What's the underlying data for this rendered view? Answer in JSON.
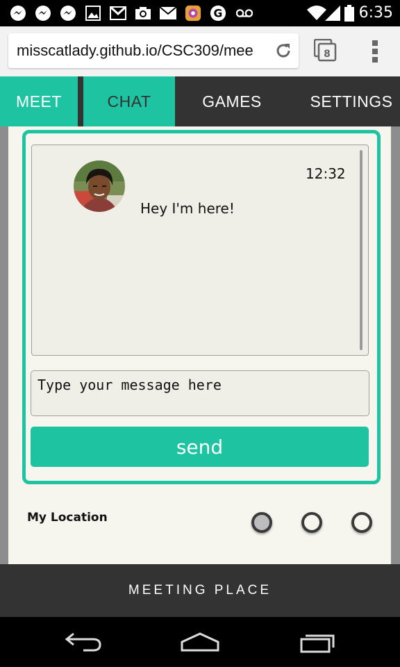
{
  "status_bar": {
    "time": "6:35",
    "icons": [
      "messenger-icon",
      "messenger-icon",
      "messenger-icon",
      "image-icon",
      "gmail-icon",
      "camera-icon",
      "mail-icon",
      "instagram-icon",
      "google-icon",
      "voicemail-icon",
      "wifi-icon",
      "signal-icon",
      "battery-icon"
    ]
  },
  "browser": {
    "url": "misscatlady.github.io/CSC309/mee",
    "tab_count": "8"
  },
  "nav": {
    "tabs": [
      {
        "label": "MEET"
      },
      {
        "label": "CHAT"
      },
      {
        "label": "GAMES"
      },
      {
        "label": "SETTINGS"
      }
    ],
    "active": "CHAT"
  },
  "chat": {
    "message": {
      "time": "12:32",
      "text": "Hey I'm here!"
    },
    "input_placeholder": "Type your message here",
    "send_label": "send"
  },
  "location": {
    "label": "My Location",
    "options": 3,
    "selected_index": 0
  },
  "footer": {
    "label": "MEETING PLACE"
  },
  "colors": {
    "accent": "#1ec4a2",
    "dark": "#333333",
    "card": "#f6f6ef"
  }
}
